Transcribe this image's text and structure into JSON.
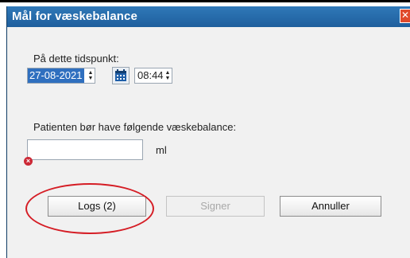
{
  "dialog": {
    "title": "Mål for væskebalance",
    "close_label": "✕"
  },
  "time": {
    "label": "På dette tidspunkt:",
    "date_value": "27-08-2021",
    "time_value": "08:44"
  },
  "fluid": {
    "label": "Patienten bør have følgende væskebalance:",
    "value": "",
    "unit": "ml"
  },
  "buttons": {
    "logs": "Logs (2)",
    "sign": "Signer",
    "cancel": "Annuller"
  },
  "colors": {
    "titlebar": "#2f78b8",
    "highlight": "#2f6fbf",
    "annotation": "#d51d25",
    "error": "#cc2936"
  },
  "icons": {
    "calendar": "calendar-icon",
    "error": "error-icon",
    "spinner": "spinner-icon"
  }
}
